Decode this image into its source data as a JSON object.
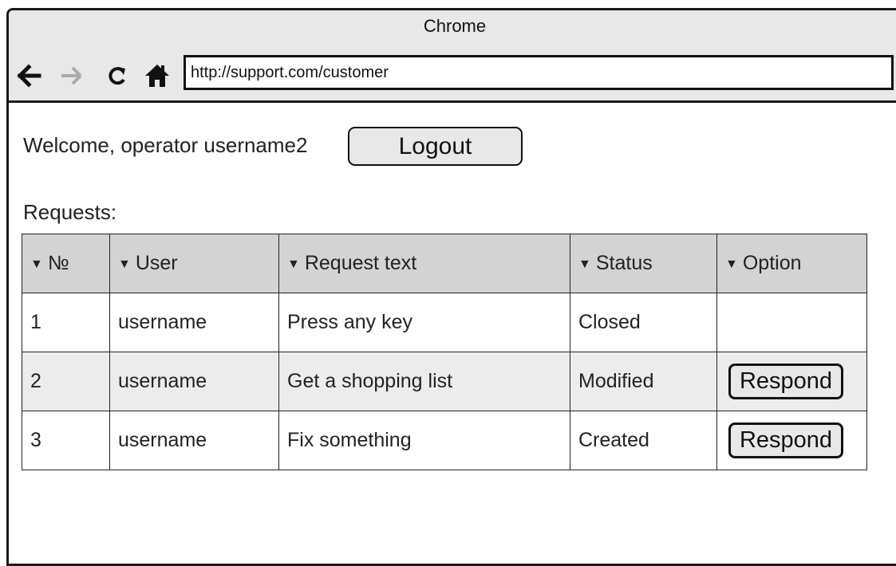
{
  "browser": {
    "title": "Chrome",
    "url": "http://support.com/customer",
    "icons": [
      "back-arrow-icon",
      "forward-arrow-icon",
      "reload-icon",
      "home-icon"
    ]
  },
  "header": {
    "welcome": "Welcome, operator username2",
    "logout_label": "Logout"
  },
  "requests": {
    "label": "Requests:",
    "sort_glyph": "▼",
    "columns": [
      "№",
      "User",
      "Request text",
      "Status",
      "Option"
    ],
    "rows": [
      {
        "num": "1",
        "user": "username",
        "text": "Press any key",
        "status": "Closed",
        "option": ""
      },
      {
        "num": "2",
        "user": "username",
        "text": "Get a shopping list",
        "status": "Modified",
        "option": "Respond"
      },
      {
        "num": "3",
        "user": "username",
        "text": "Fix something",
        "status": "Created",
        "option": "Respond"
      }
    ]
  },
  "colors": {
    "chrome_bg": "#e8e8e8",
    "header_bg": "#d3d3d3",
    "shaded_row": "#ececec",
    "forward_disabled": "#aaaaaa"
  }
}
